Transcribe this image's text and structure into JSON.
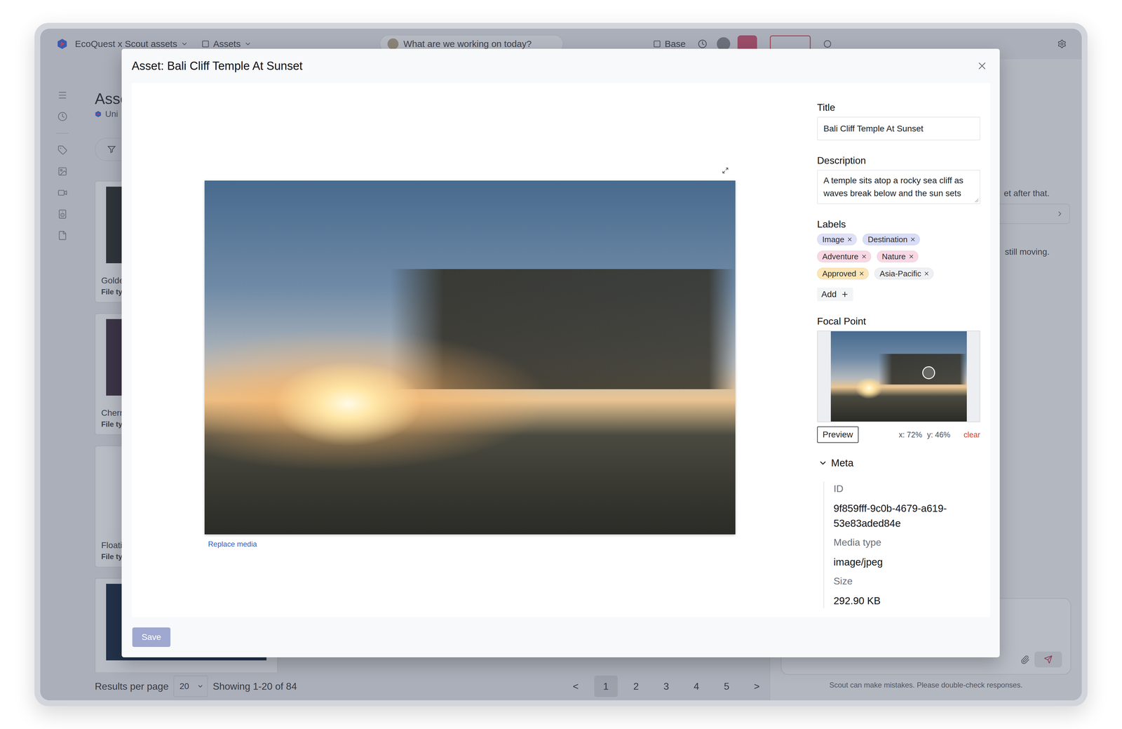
{
  "app": {
    "topbar": {
      "workspace": "EcoQuest x Scout assets",
      "section": "Assets",
      "search_placeholder": "What are we working on today?",
      "base": "Base"
    },
    "page": {
      "title": "Asse",
      "subtitle": "Uni",
      "filter": "F"
    },
    "cards": [
      {
        "title": "Golde",
        "meta": "File ty",
        "image_color": "#2f353b"
      },
      {
        "title": "Cherr",
        "meta": "File ty",
        "image_color": "#3b3547"
      },
      {
        "title": "Floati",
        "meta": "File ty",
        "image_color": "#b9bdc5"
      },
      {
        "image_color": "#23324a"
      }
    ],
    "pager": {
      "results_label": "Results per page",
      "per_page": "20",
      "showing": "Showing 1-20 of 84",
      "prev": "<",
      "next": ">",
      "pages": [
        {
          "label": "1",
          "selected": true
        },
        {
          "label": "2",
          "selected": false
        },
        {
          "label": "3",
          "selected": false
        },
        {
          "label": "4",
          "selected": false
        },
        {
          "label": "5",
          "selected": false
        }
      ]
    },
    "chat": {
      "messages": [
        "et after that.",
        "still moving."
      ],
      "disclaimer": "Scout can make mistakes. Please double-check responses."
    }
  },
  "modal": {
    "title": "Asset: Bali Cliff Temple At Sunset",
    "replace_media": "Replace media",
    "fields": {
      "title_label": "Title",
      "title_value": "Bali Cliff Temple At Sunset",
      "description_label": "Description",
      "description_value": "A temple sits atop a rocky sea cliff as waves break below and the sun sets"
    },
    "labels": {
      "heading": "Labels",
      "add": "Add",
      "items": [
        {
          "label": "Image",
          "color": "#dfe1f8"
        },
        {
          "label": "Destination",
          "color": "#d8ddf8"
        },
        {
          "label": "Adventure",
          "color": "#f9d8e4"
        },
        {
          "label": "Nature",
          "color": "#f9d8e4"
        },
        {
          "label": "Approved",
          "color": "#fde5b6"
        },
        {
          "label": "Asia-Pacific",
          "color": "#eef0f3"
        }
      ]
    },
    "focal_point": {
      "heading": "Focal Point",
      "x": 0.72,
      "y": 0.46,
      "x_reading": "x: 72%",
      "y_reading": "y: 46%",
      "preview": "Preview",
      "clear": "clear"
    },
    "meta": {
      "heading": "Meta",
      "expanded": true,
      "items": [
        {
          "label": "ID",
          "value": "9f859fff-9c0b-4679-a619-53e83aded84e"
        },
        {
          "label": "Media type",
          "value": "image/jpeg"
        },
        {
          "label": "Size",
          "value": "292.90 KB"
        }
      ]
    },
    "save": {
      "label": "Save",
      "disabled": true
    }
  }
}
